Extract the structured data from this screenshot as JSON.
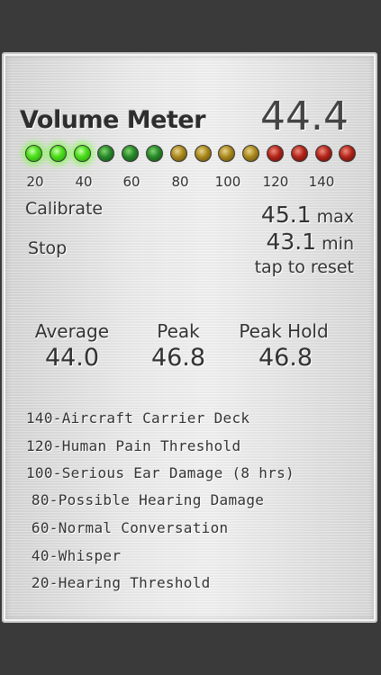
{
  "header": {
    "title": "Volume Meter",
    "current_level": "44.4"
  },
  "meter": {
    "leds": [
      {
        "color": "green",
        "on": true
      },
      {
        "color": "green",
        "on": true
      },
      {
        "color": "green",
        "on": true
      },
      {
        "color": "green",
        "on": false
      },
      {
        "color": "green",
        "on": false
      },
      {
        "color": "green",
        "on": false
      },
      {
        "color": "yellow",
        "on": false
      },
      {
        "color": "yellow",
        "on": false
      },
      {
        "color": "yellow",
        "on": false
      },
      {
        "color": "yellow",
        "on": false
      },
      {
        "color": "red",
        "on": false
      },
      {
        "color": "red",
        "on": false
      },
      {
        "color": "red",
        "on": false
      },
      {
        "color": "red",
        "on": false
      }
    ],
    "scale": [
      "20",
      "40",
      "60",
      "80",
      "100",
      "120",
      "140"
    ]
  },
  "controls": {
    "calibrate_label": "Calibrate",
    "stop_label": "Stop"
  },
  "range": {
    "max_value": "45.1",
    "max_label": "max",
    "min_value": "43.1",
    "min_label": "min",
    "reset_label": "tap to reset"
  },
  "stats": {
    "average_label": "Average",
    "average_value": "44.0",
    "peak_label": "Peak",
    "peak_value": "46.8",
    "peak_hold_label": "Peak Hold",
    "peak_hold_value": "46.8"
  },
  "reference": [
    "140-Aircraft Carrier Deck",
    "120-Human Pain Threshold",
    "100-Serious Ear Damage (8 hrs)",
    " 80-Possible Hearing Damage",
    " 60-Normal Conversation",
    " 40-Whisper",
    " 20-Hearing Threshold"
  ],
  "colors": {
    "led_on": "#4fe01c",
    "led_green": "#27862a",
    "led_yellow": "#a8861d",
    "led_red": "#b0241a",
    "text": "#333333"
  }
}
